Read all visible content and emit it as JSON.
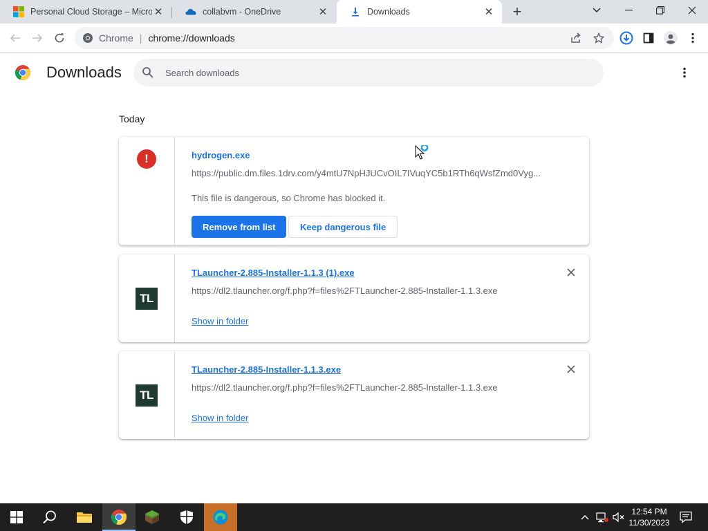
{
  "tabs": [
    {
      "title": "Personal Cloud Storage – Microsoft",
      "icon": "microsoft-logo-icon"
    },
    {
      "title": "collabvm - OneDrive",
      "icon": "onedrive-cloud-icon"
    },
    {
      "title": "Downloads",
      "icon": "download-icon",
      "active": true
    }
  ],
  "toolbar": {
    "chip": "Chrome",
    "url": "chrome://downloads"
  },
  "page": {
    "title": "Downloads",
    "search_placeholder": "Search downloads",
    "section": "Today"
  },
  "downloads": [
    {
      "filename": "hydrogen.exe",
      "url": "https://public.dm.files.1drv.com/y4mtU7NpHJUCvOIL7IVuqYC5b1RTh6qWsfZmd0Vyg...",
      "status": "This file is dangerous, so Chrome has blocked it.",
      "primary_action": "Remove from list",
      "secondary_action": "Keep dangerous file",
      "icon": "danger-icon"
    },
    {
      "filename": "TLauncher-2.885-Installer-1.1.3 (1).exe",
      "url": "https://dl2.tlauncher.org/f.php?f=files%2FTLauncher-2.885-Installer-1.1.3.exe",
      "action": "Show in folder",
      "icon_text": "TL"
    },
    {
      "filename": "TLauncher-2.885-Installer-1.1.3.exe",
      "url": "https://dl2.tlauncher.org/f.php?f=files%2FTLauncher-2.885-Installer-1.1.3.exe",
      "action": "Show in folder",
      "icon_text": "TL"
    }
  ],
  "taskbar": {
    "time": "12:54 PM",
    "date": "11/30/2023"
  },
  "colors": {
    "accent": "#1a73e8",
    "danger": "#d93025",
    "tab_strip": "#dee1e6",
    "taskbar": "#1f1f1f"
  }
}
